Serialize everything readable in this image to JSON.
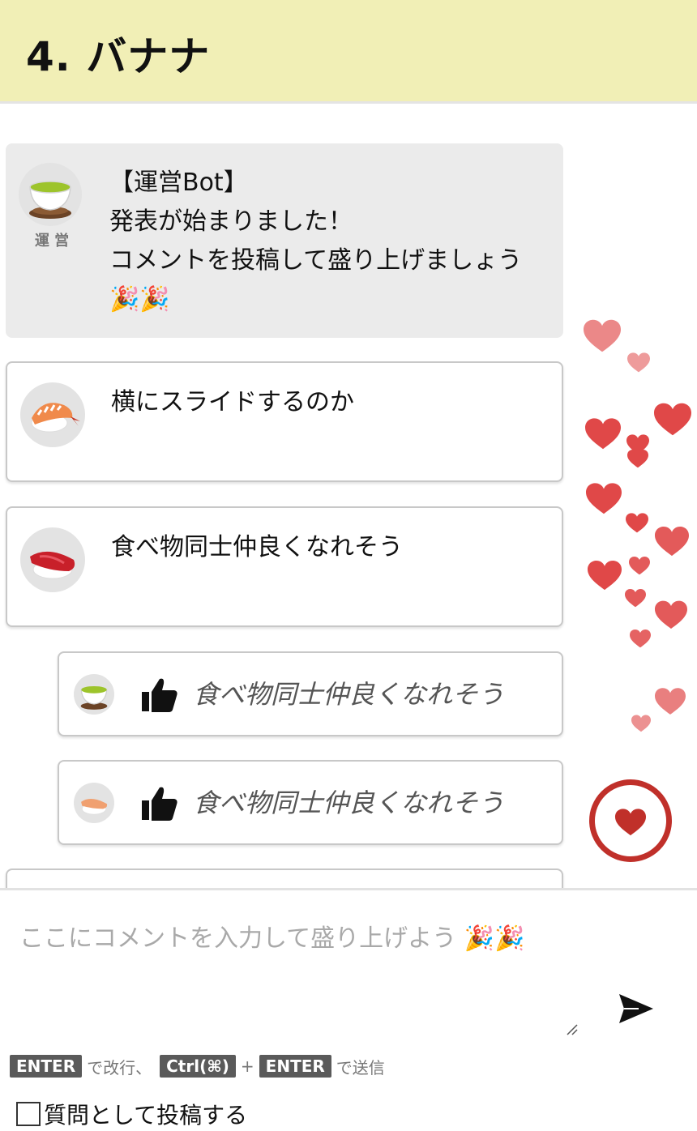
{
  "header": {
    "title": "4. バナナ"
  },
  "feed": {
    "bot_message": {
      "avatar_label": "運 営",
      "text": "【運営Bot】\n発表が始まりました！\nコメントを投稿して盛り上げましょう\n🎉🎉"
    },
    "comments": [
      {
        "avatar": "shrimp-sushi",
        "text": "横にスライドするのか"
      },
      {
        "avatar": "tuna-sushi",
        "text": "食べ物同士仲良くなれそう"
      }
    ],
    "likes": [
      {
        "avatar": "green-tea",
        "text": "食べ物同士仲良くなれそう"
      },
      {
        "avatar": "sushi",
        "text": "食べ物同士仲良くなれそう"
      }
    ]
  },
  "colors": {
    "header_bg": "#f1efb6",
    "heart": "#e04848",
    "like_button": "#c0302a"
  },
  "composer": {
    "placeholder": "ここにコメントを入力して盛り上げよう 🎉🎉",
    "hint": {
      "key_enter": "ENTER",
      "newline_text": "で改行、",
      "key_ctrl": "Ctrl(⌘)",
      "plus": "+",
      "key_enter2": "ENTER",
      "send_text": "で送信"
    },
    "question_label": "質問として投稿する"
  }
}
